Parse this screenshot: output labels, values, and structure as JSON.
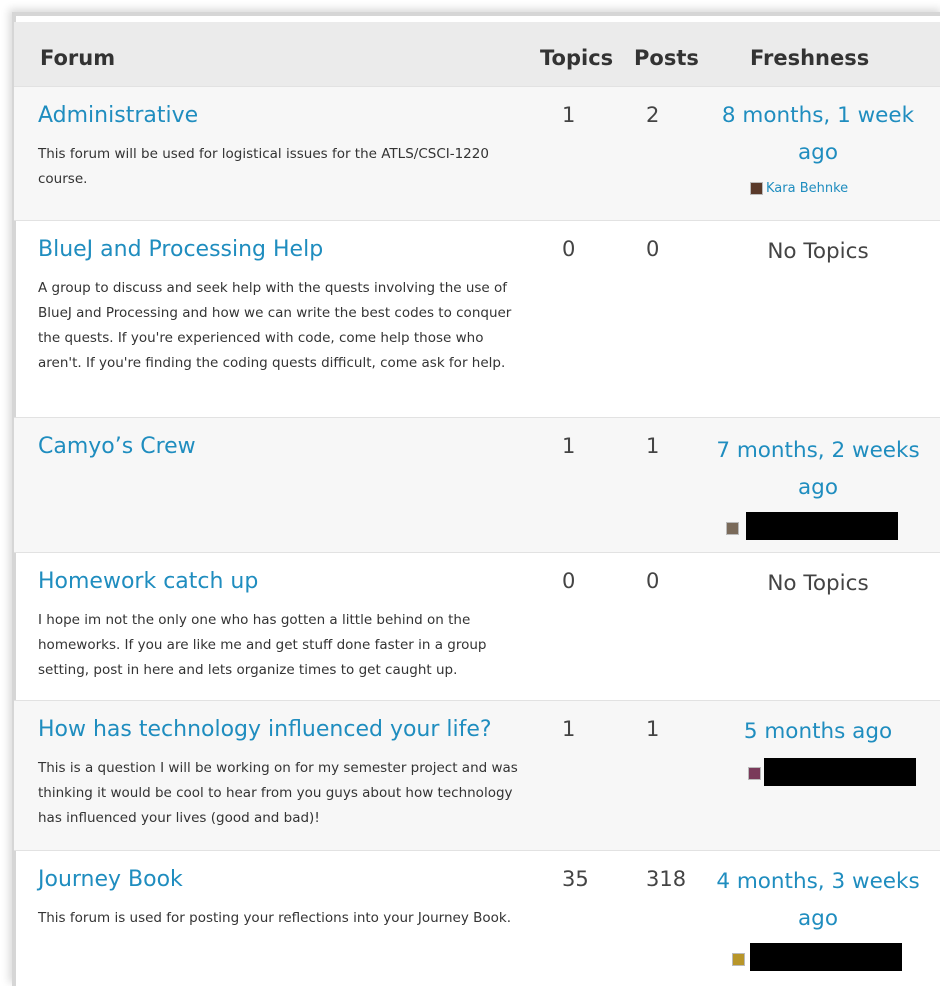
{
  "header": {
    "forum": "Forum",
    "topics": "Topics",
    "posts": "Posts",
    "freshness": "Freshness"
  },
  "rows": [
    {
      "title": "Administrative",
      "description": "This forum will be used for logistical issues for the ATLS/CSCI-1220 course.",
      "topics": "1",
      "posts": "2",
      "freshness": "8 months, 1 week ago",
      "author": "Kara Behnke"
    },
    {
      "title": "BlueJ and Processing Help",
      "description": "A group to discuss and seek help with the quests involving the use of BlueJ and Processing and how we can write the best codes to conquer the quests. If you're experienced with code, come help those who aren't. If you're finding the coding quests difficult, come ask for help.",
      "topics": "0",
      "posts": "0",
      "freshness": "No Topics"
    },
    {
      "title": "Camyo’s Crew",
      "description": "",
      "topics": "1",
      "posts": "1",
      "freshness": "7 months, 2 weeks ago"
    },
    {
      "title": "Homework catch up",
      "description": "I hope im not the only one who has gotten a little behind on the homeworks. If you are like me and get stuff done faster in a group setting, post in here and lets organize times to get caught up.",
      "topics": "0",
      "posts": "0",
      "freshness": "No Topics"
    },
    {
      "title": "How has technology influenced your life?",
      "description": "This is a question I will be working on for my semester project and was thinking it would be cool to hear from you guys about how technology has influenced your lives (good and bad)!",
      "topics": "1",
      "posts": "1",
      "freshness": "5 months ago"
    },
    {
      "title": "Journey Book",
      "description": "This forum is used for posting your reflections into your Journey Book.",
      "topics": "35",
      "posts": "318",
      "freshness": "4 months, 3 weeks ago"
    }
  ]
}
